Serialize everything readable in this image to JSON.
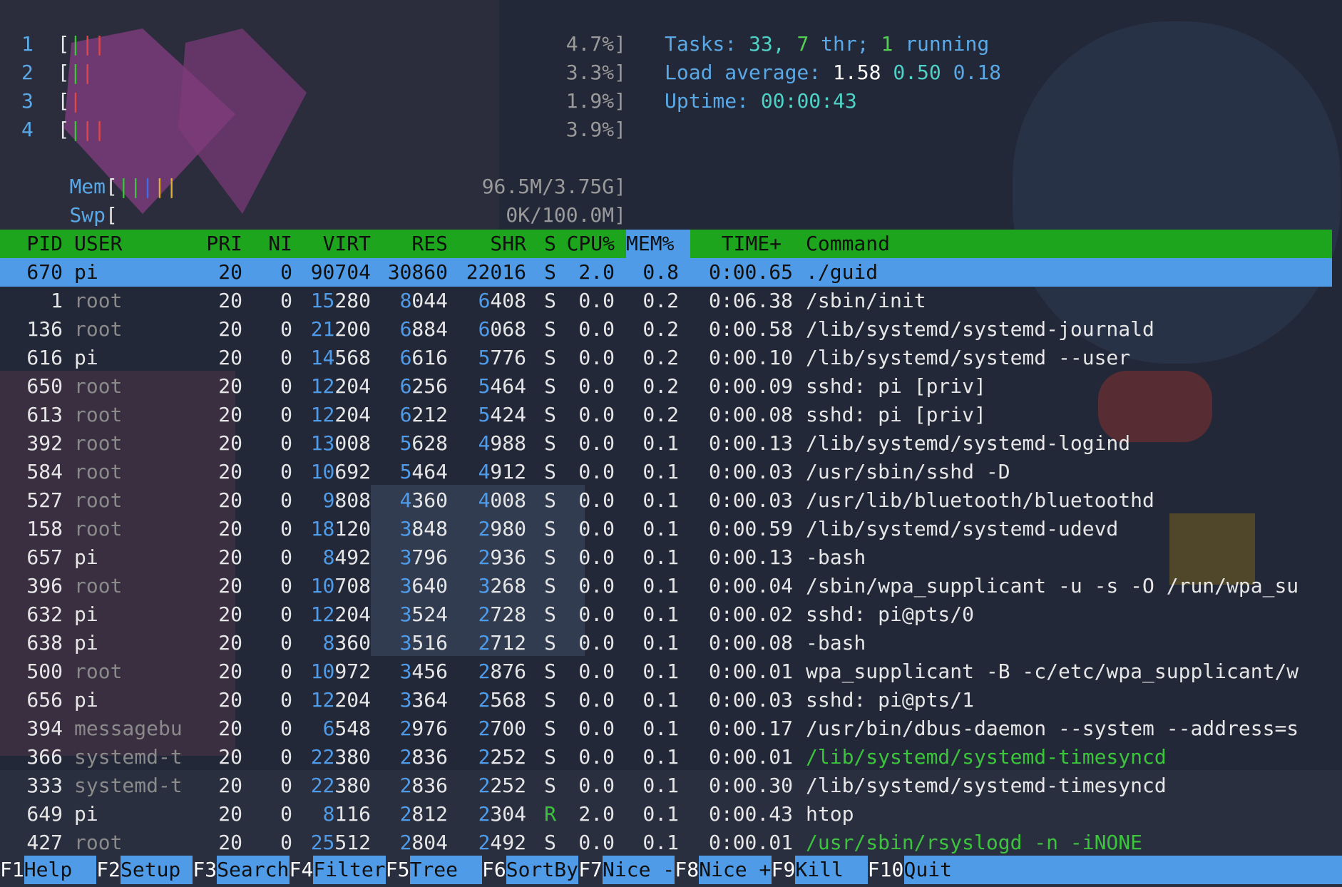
{
  "meters": {
    "cpus": [
      {
        "label": "1",
        "value": "4.7%]"
      },
      {
        "label": "2",
        "value": "3.3%]"
      },
      {
        "label": "3",
        "value": "1.9%]"
      },
      {
        "label": "4",
        "value": "3.9%]"
      }
    ],
    "mem": {
      "label": "Mem",
      "value": "96.5M/3.75G]"
    },
    "swp": {
      "label": "Swp",
      "value": "0K/100.0M]"
    }
  },
  "stats": {
    "tasks_label": "Tasks:",
    "tasks_count": "33,",
    "threads": "7",
    "thr_label": "thr;",
    "running": "1",
    "running_label": "running",
    "load_label": "Load average:",
    "load1": "1.58",
    "load5": "0.50",
    "load15": "0.18",
    "uptime_label": "Uptime:",
    "uptime": "00:00:43"
  },
  "columns": [
    "PID",
    "USER",
    "PRI",
    "NI",
    "VIRT",
    "RES",
    "SHR",
    "S",
    "CPU%",
    "MEM%",
    "TIME+",
    "Command"
  ],
  "processes": [
    {
      "pid": "670",
      "user": "pi",
      "pri": "20",
      "ni": "0",
      "virt": "90704",
      "res": "30860",
      "shr": "22016",
      "s": "S",
      "cpu": "2.0",
      "mem": "0.8",
      "time": "0:00.65",
      "cmd": "./guid"
    },
    {
      "pid": "1",
      "user": "root",
      "pri": "20",
      "ni": "0",
      "virt": "15280",
      "res": "8044",
      "shr": "6408",
      "s": "S",
      "cpu": "0.0",
      "mem": "0.2",
      "time": "0:06.38",
      "cmd": "/sbin/init"
    },
    {
      "pid": "136",
      "user": "root",
      "pri": "20",
      "ni": "0",
      "virt": "21200",
      "res": "6884",
      "shr": "6068",
      "s": "S",
      "cpu": "0.0",
      "mem": "0.2",
      "time": "0:00.58",
      "cmd": "/lib/systemd/systemd-journald"
    },
    {
      "pid": "616",
      "user": "pi",
      "pri": "20",
      "ni": "0",
      "virt": "14568",
      "res": "6616",
      "shr": "5776",
      "s": "S",
      "cpu": "0.0",
      "mem": "0.2",
      "time": "0:00.10",
      "cmd": "/lib/systemd/systemd --user"
    },
    {
      "pid": "650",
      "user": "root",
      "pri": "20",
      "ni": "0",
      "virt": "12204",
      "res": "6256",
      "shr": "5464",
      "s": "S",
      "cpu": "0.0",
      "mem": "0.2",
      "time": "0:00.09",
      "cmd": "sshd: pi [priv]"
    },
    {
      "pid": "613",
      "user": "root",
      "pri": "20",
      "ni": "0",
      "virt": "12204",
      "res": "6212",
      "shr": "5424",
      "s": "S",
      "cpu": "0.0",
      "mem": "0.2",
      "time": "0:00.08",
      "cmd": "sshd: pi [priv]"
    },
    {
      "pid": "392",
      "user": "root",
      "pri": "20",
      "ni": "0",
      "virt": "13008",
      "res": "5628",
      "shr": "4988",
      "s": "S",
      "cpu": "0.0",
      "mem": "0.1",
      "time": "0:00.13",
      "cmd": "/lib/systemd/systemd-logind"
    },
    {
      "pid": "584",
      "user": "root",
      "pri": "20",
      "ni": "0",
      "virt": "10692",
      "res": "5464",
      "shr": "4912",
      "s": "S",
      "cpu": "0.0",
      "mem": "0.1",
      "time": "0:00.03",
      "cmd": "/usr/sbin/sshd -D"
    },
    {
      "pid": "527",
      "user": "root",
      "pri": "20",
      "ni": "0",
      "virt": "9808",
      "res": "4360",
      "shr": "4008",
      "s": "S",
      "cpu": "0.0",
      "mem": "0.1",
      "time": "0:00.03",
      "cmd": "/usr/lib/bluetooth/bluetoothd"
    },
    {
      "pid": "158",
      "user": "root",
      "pri": "20",
      "ni": "0",
      "virt": "18120",
      "res": "3848",
      "shr": "2980",
      "s": "S",
      "cpu": "0.0",
      "mem": "0.1",
      "time": "0:00.59",
      "cmd": "/lib/systemd/systemd-udevd"
    },
    {
      "pid": "657",
      "user": "pi",
      "pri": "20",
      "ni": "0",
      "virt": "8492",
      "res": "3796",
      "shr": "2936",
      "s": "S",
      "cpu": "0.0",
      "mem": "0.1",
      "time": "0:00.13",
      "cmd": "-bash"
    },
    {
      "pid": "396",
      "user": "root",
      "pri": "20",
      "ni": "0",
      "virt": "10708",
      "res": "3640",
      "shr": "3268",
      "s": "S",
      "cpu": "0.0",
      "mem": "0.1",
      "time": "0:00.04",
      "cmd": "/sbin/wpa_supplicant -u -s -O /run/wpa_su"
    },
    {
      "pid": "632",
      "user": "pi",
      "pri": "20",
      "ni": "0",
      "virt": "12204",
      "res": "3524",
      "shr": "2728",
      "s": "S",
      "cpu": "0.0",
      "mem": "0.1",
      "time": "0:00.02",
      "cmd": "sshd: pi@pts/0"
    },
    {
      "pid": "638",
      "user": "pi",
      "pri": "20",
      "ni": "0",
      "virt": "8360",
      "res": "3516",
      "shr": "2712",
      "s": "S",
      "cpu": "0.0",
      "mem": "0.1",
      "time": "0:00.08",
      "cmd": "-bash"
    },
    {
      "pid": "500",
      "user": "root",
      "pri": "20",
      "ni": "0",
      "virt": "10972",
      "res": "3456",
      "shr": "2876",
      "s": "S",
      "cpu": "0.0",
      "mem": "0.1",
      "time": "0:00.01",
      "cmd": "wpa_supplicant -B -c/etc/wpa_supplicant/w"
    },
    {
      "pid": "656",
      "user": "pi",
      "pri": "20",
      "ni": "0",
      "virt": "12204",
      "res": "3364",
      "shr": "2568",
      "s": "S",
      "cpu": "0.0",
      "mem": "0.1",
      "time": "0:00.03",
      "cmd": "sshd: pi@pts/1"
    },
    {
      "pid": "394",
      "user": "messagebu",
      "pri": "20",
      "ni": "0",
      "virt": "6548",
      "res": "2976",
      "shr": "2700",
      "s": "S",
      "cpu": "0.0",
      "mem": "0.1",
      "time": "0:00.17",
      "cmd": "/usr/bin/dbus-daemon --system --address=s"
    },
    {
      "pid": "366",
      "user": "systemd-t",
      "pri": "20",
      "ni": "0",
      "virt": "22380",
      "res": "2836",
      "shr": "2252",
      "s": "S",
      "cpu": "0.0",
      "mem": "0.1",
      "time": "0:00.01",
      "cmd": "/lib/systemd/systemd-timesyncd",
      "green": true
    },
    {
      "pid": "333",
      "user": "systemd-t",
      "pri": "20",
      "ni": "0",
      "virt": "22380",
      "res": "2836",
      "shr": "2252",
      "s": "S",
      "cpu": "0.0",
      "mem": "0.1",
      "time": "0:00.30",
      "cmd": "/lib/systemd/systemd-timesyncd"
    },
    {
      "pid": "649",
      "user": "pi",
      "pri": "20",
      "ni": "0",
      "virt": "8116",
      "res": "2812",
      "shr": "2304",
      "s": "R",
      "cpu": "2.0",
      "mem": "0.1",
      "time": "0:00.43",
      "cmd": "htop"
    },
    {
      "pid": "427",
      "user": "root",
      "pri": "20",
      "ni": "0",
      "virt": "25512",
      "res": "2804",
      "shr": "2492",
      "s": "S",
      "cpu": "0.0",
      "mem": "0.1",
      "time": "0:00.01",
      "cmd": "/usr/sbin/rsyslogd -n -iNONE",
      "green": true
    }
  ],
  "footer": [
    {
      "key": "F1",
      "label": "Help  "
    },
    {
      "key": "F2",
      "label": "Setup "
    },
    {
      "key": "F3",
      "label": "Search"
    },
    {
      "key": "F4",
      "label": "Filter"
    },
    {
      "key": "F5",
      "label": "Tree  "
    },
    {
      "key": "F6",
      "label": "SortBy"
    },
    {
      "key": "F7",
      "label": "Nice -"
    },
    {
      "key": "F8",
      "label": "Nice +"
    },
    {
      "key": "F9",
      "label": "Kill  "
    },
    {
      "key": "F10",
      "label": "Quit"
    }
  ],
  "colors": {
    "header_bg": "#1da51d",
    "selected_bg": "#4f9be8",
    "label_blue": "#5aa9e6"
  }
}
